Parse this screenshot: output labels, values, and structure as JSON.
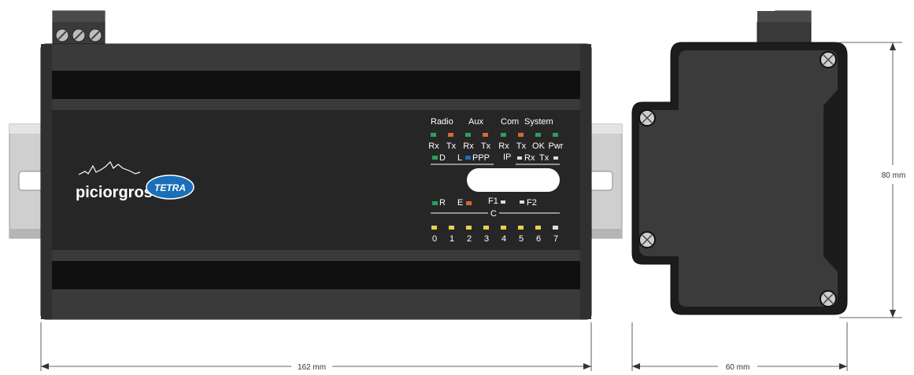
{
  "colors": {
    "body": "#262626",
    "body_light": "#3a3a3a",
    "rail": "#cfcfcf",
    "side_view": "#3b3b3b",
    "led_green": "#2e9e5e",
    "led_orange": "#d2693a",
    "led_yellow": "#e6d24a",
    "led_white": "#dddddd",
    "tetra_blue": "#1a6fb8"
  },
  "front_view": {
    "brand": "piciorgros",
    "logo_text": "TETRA",
    "group_labels": {
      "radio": "Radio",
      "aux": "Aux",
      "com": "Com",
      "system": "System"
    },
    "led_labels": [
      "Rx",
      "Tx",
      "Rx",
      "Tx",
      "Rx",
      "Tx",
      "OK",
      "Pwr"
    ],
    "row2": {
      "d": "D",
      "l": "L",
      "ppp": "PPP",
      "ip": "IP",
      "ip_rx": "Rx",
      "ip_tx": "Tx"
    },
    "row3": {
      "r": "R",
      "e": "E",
      "f1": "F1",
      "f2": "F2",
      "c": "C"
    },
    "channel_labels": [
      "0",
      "1",
      "2",
      "3",
      "4",
      "5",
      "6",
      "7"
    ]
  },
  "dimensions": {
    "width_front": "162 mm",
    "width_side": "60 mm",
    "height_side": "80 mm"
  }
}
